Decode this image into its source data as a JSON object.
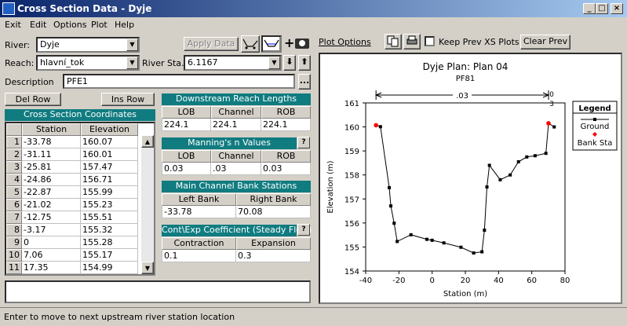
{
  "window": {
    "title": "Cross Section Data - Dyje",
    "min": "_",
    "max": "□",
    "close": "×"
  },
  "menu": [
    "Exit",
    "Edit",
    "Options",
    "Plot",
    "Help"
  ],
  "river": {
    "label": "River:",
    "value": "Dyje"
  },
  "reach": {
    "label": "Reach:",
    "value": "hlavní_tok"
  },
  "river_sta": {
    "label": "River Sta.:",
    "value": "6.1167"
  },
  "apply_data": "Apply Data",
  "description": {
    "label": "Description",
    "value": "PFE1",
    "browse": "..."
  },
  "del_row": "Del Row",
  "ins_row": "Ins Row",
  "xs_coords": {
    "title": "Cross Section Coordinates",
    "headers": [
      "Station",
      "Elevation"
    ],
    "rows": [
      [
        "1",
        "-33.78",
        "160.07"
      ],
      [
        "2",
        "-31.11",
        "160.01"
      ],
      [
        "3",
        "-25.81",
        "157.47"
      ],
      [
        "4",
        "-24.86",
        "156.71"
      ],
      [
        "5",
        "-22.87",
        "155.99"
      ],
      [
        "6",
        "-21.02",
        "155.23"
      ],
      [
        "7",
        "-12.75",
        "155.51"
      ],
      [
        "8",
        "-3.17",
        "155.32"
      ],
      [
        "9",
        "0",
        "155.28"
      ],
      [
        "10",
        "7.06",
        "155.17"
      ],
      [
        "11",
        "17.35",
        "154.99"
      ]
    ]
  },
  "downstream": {
    "title": "Downstream Reach Lengths",
    "headers": [
      "LOB",
      "Channel",
      "ROB"
    ],
    "values": [
      "224.1",
      "224.1",
      "224.1"
    ]
  },
  "mannings": {
    "title": "Manning's n Values",
    "headers": [
      "LOB",
      "Channel",
      "ROB"
    ],
    "values": [
      "0.03",
      ".03",
      "0.03"
    ],
    "help": "?"
  },
  "bank": {
    "title": "Main Channel Bank Stations",
    "headers": [
      "Left Bank",
      "Right Bank"
    ],
    "values": [
      "-33.78",
      "70.08"
    ]
  },
  "contexp": {
    "title": "Cont\\Exp Coefficient (Steady Flow)",
    "headers": [
      "Contraction",
      "Expansion"
    ],
    "values": [
      "0.1",
      "0.3"
    ],
    "help": "?"
  },
  "plot_options": "Plot Options",
  "keep_prev": {
    "label": "Keep Prev XS Plots",
    "checked": false
  },
  "clear_prev": "Clear Prev",
  "status_text": "Enter to move to next upstream river station location",
  "chart_data": {
    "type": "line",
    "title": "Dyje      Plan: Plan 04",
    "subtitle": "PF81",
    "xlabel": "Station (m)",
    "ylabel": "Elevation (m)",
    "xlim": [
      -40,
      80
    ],
    "ylim": [
      154,
      161
    ],
    "xticks": [
      "-40",
      "-20",
      "0",
      "20",
      "40",
      "60",
      "80"
    ],
    "yticks": [
      "154",
      "155",
      "156",
      "157",
      "158",
      "159",
      "160",
      "161"
    ],
    "n_label": ".03",
    "right_labels": [
      "0",
      "3"
    ],
    "legend": {
      "title": "Legend",
      "items": [
        "Ground",
        "Bank Sta"
      ]
    },
    "series": [
      {
        "name": "Ground",
        "color": "#000000",
        "x": [
          -33.78,
          -31.11,
          -25.81,
          -24.86,
          -22.87,
          -21.02,
          -12.75,
          -3.17,
          0,
          7.06,
          17.35,
          25,
          30,
          31.5,
          33,
          34.5,
          41,
          47,
          52,
          57,
          62,
          68.5,
          70.08,
          73.5
        ],
        "y": [
          160.07,
          160.01,
          157.47,
          156.71,
          155.99,
          155.23,
          155.51,
          155.32,
          155.28,
          155.17,
          154.99,
          154.75,
          154.8,
          155.7,
          157.5,
          158.4,
          157.8,
          158.0,
          158.55,
          158.75,
          158.8,
          158.9,
          160.15,
          160.0
        ]
      }
    ],
    "bank_stations": {
      "name": "Bank Sta",
      "color": "#ff0000",
      "x": [
        -33.78,
        70.08
      ],
      "y": [
        160.07,
        160.15
      ]
    }
  }
}
